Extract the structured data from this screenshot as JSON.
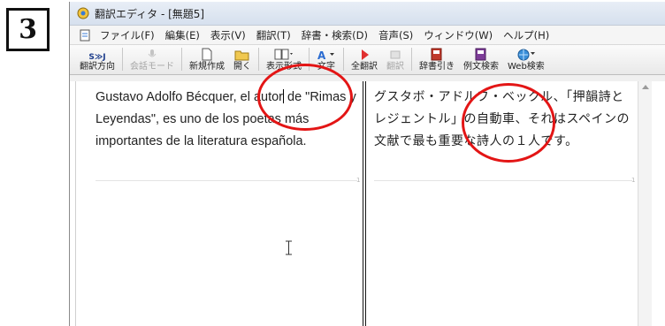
{
  "step": {
    "number": "3"
  },
  "window": {
    "title": "翻訳エディタ - [無題5]",
    "icon": "gear-app-icon"
  },
  "menu": {
    "doc_icon": "document-icon",
    "items": [
      "ファイル(F)",
      "編集(E)",
      "表示(V)",
      "翻訳(T)",
      "辞書・検索(D)",
      "音声(S)",
      "ウィンドウ(W)",
      "ヘルプ(H)"
    ]
  },
  "toolbar": {
    "translate_direction": "翻訳方向",
    "translate_direction_icon_text": "S≫J",
    "conversation_mode": "会話モード",
    "new": "新規作成",
    "open": "開く",
    "display_format": "表示形式",
    "text_style": "文字",
    "translate_all": "全翻訳",
    "translate": "翻訳",
    "dict_lookup": "辞書引き",
    "example_search": "例文検索",
    "web_search": "Web検索"
  },
  "editor": {
    "source_before_caret": "Gustavo Adolfo Bécquer, el autor",
    "source_after_caret": " de \"Rimas y Leyendas\", es uno de los poetas más importantes de la literatura española.",
    "target": "グスタボ・アドルフ・ベックル、「押韻詩とレジェントル」の自動車、それはスペインの文献で最も重要な詩人の１人です。",
    "sentence_marker": "1"
  },
  "colors": {
    "highlight_circle": "#e31515",
    "translate_arrow": "#e03030"
  }
}
